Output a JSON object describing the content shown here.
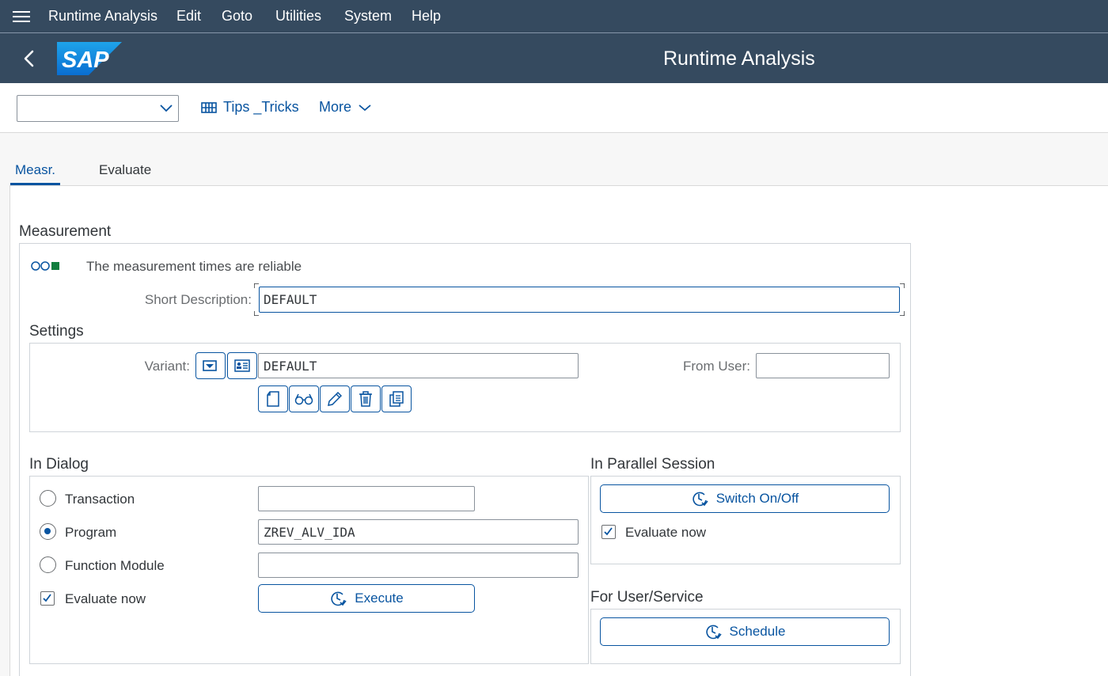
{
  "menubar": {
    "items": [
      "Runtime Analysis",
      "Edit",
      "Goto",
      "Utilities",
      "System",
      "Help"
    ]
  },
  "shell": {
    "title": "Runtime Analysis",
    "logo_text": "SAP"
  },
  "toolbar": {
    "tips_label": "Tips _Tricks",
    "more_label": "More"
  },
  "tabs": [
    "Measr.",
    "Evaluate"
  ],
  "measurement": {
    "title": "Measurement",
    "status_text": "The measurement times are reliable",
    "short_desc_label": "Short Description:",
    "short_desc_value": "DEFAULT"
  },
  "settings": {
    "title": "Settings",
    "variant_label": "Variant:",
    "variant_value": "DEFAULT",
    "from_user_label": "From User:",
    "from_user_value": ""
  },
  "dialog": {
    "title": "In Dialog",
    "transaction_label": "Transaction",
    "transaction_value": "",
    "program_label": "Program",
    "program_value": "ZREV_ALV_IDA",
    "function_module_label": "Function Module",
    "function_module_value": "",
    "evaluate_label": "Evaluate now",
    "execute_label": "Execute"
  },
  "parallel": {
    "title": "In Parallel Session",
    "switch_label": "Switch On/Off",
    "evaluate_label": "Evaluate now"
  },
  "user_service": {
    "title": "For User/Service",
    "schedule_label": "Schedule"
  },
  "colors": {
    "shell": "#354a5f",
    "accent": "#0854a0",
    "status_green": "#107e3e"
  }
}
